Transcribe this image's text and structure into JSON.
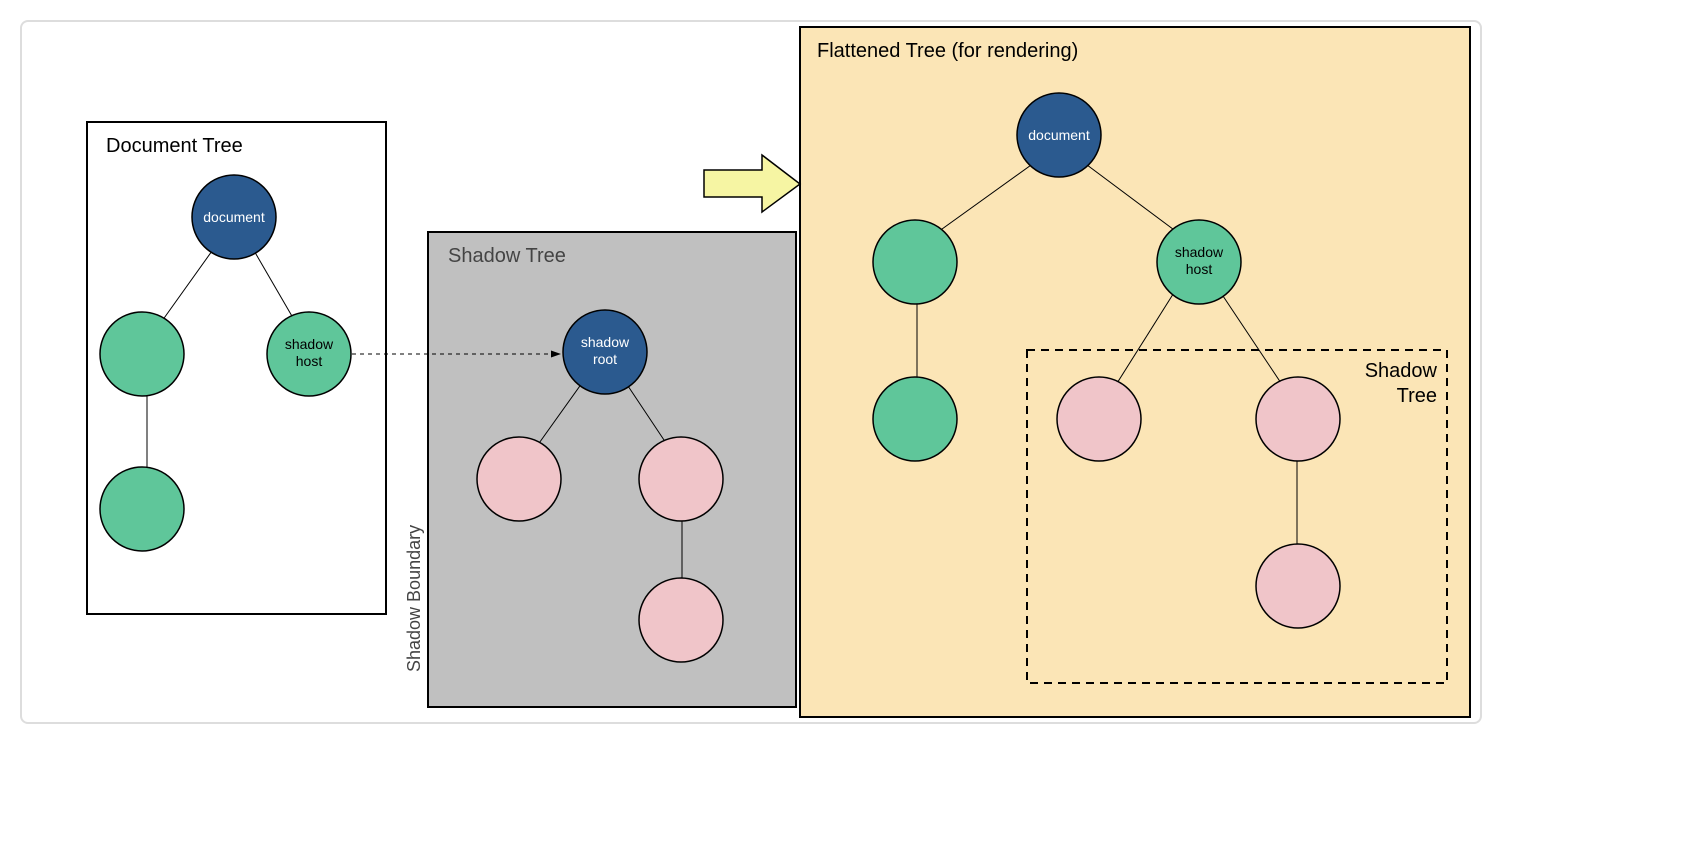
{
  "documentTree": {
    "title": "Document Tree",
    "nodes": {
      "document": "document",
      "shadowHost": "shadow\nhost"
    }
  },
  "shadowTree": {
    "title": "Shadow Tree",
    "boundaryLabel": "Shadow Boundary",
    "nodes": {
      "shadowRoot": "shadow\nroot"
    }
  },
  "flattenedTree": {
    "title": "Flattened Tree (for rendering)",
    "innerLabel": "Shadow\nTree",
    "nodes": {
      "document": "document",
      "shadowHost": "shadow\nhost"
    }
  },
  "colors": {
    "blue": "#2b5a8f",
    "green": "#5fc69a",
    "pink": "#f0c5c9",
    "gray": "#c0c0c0",
    "yellow": "#fbe5b6",
    "arrowFill": "#f6f5a3"
  }
}
